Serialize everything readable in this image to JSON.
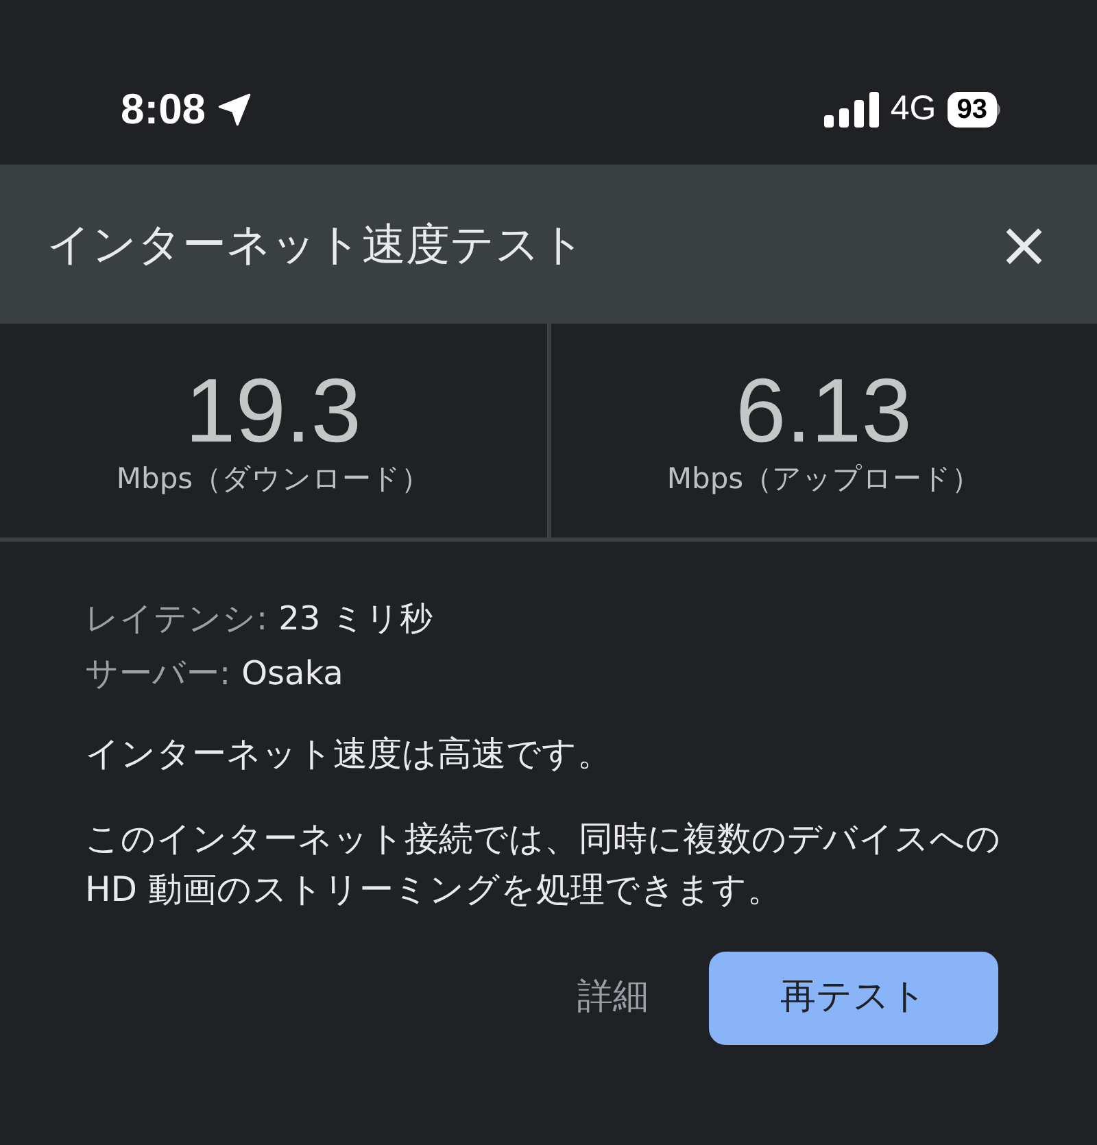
{
  "status_bar": {
    "time": "8:08",
    "network": "4G",
    "battery": "93"
  },
  "dialog": {
    "title": "インターネット速度テスト",
    "close": "×"
  },
  "results": [
    {
      "value": "19.3",
      "unit": "Mbps（ダウンロード）"
    },
    {
      "value": "6.13",
      "unit": "Mbps（アップロード）"
    }
  ],
  "details": [
    {
      "label": "レイテンシ:",
      "value": "23 ミリ秒"
    },
    {
      "label": "サーバー:",
      "value": "Osaka"
    }
  ],
  "message": "インターネット速度は高速です。",
  "description": "このインターネット接続では、同時に複数のデバイスへの HD 動画のストリーミングを処理できます。",
  "buttons": [
    {
      "label": "詳細",
      "kind": "text"
    },
    {
      "label": "再テスト",
      "kind": "filled"
    }
  ]
}
